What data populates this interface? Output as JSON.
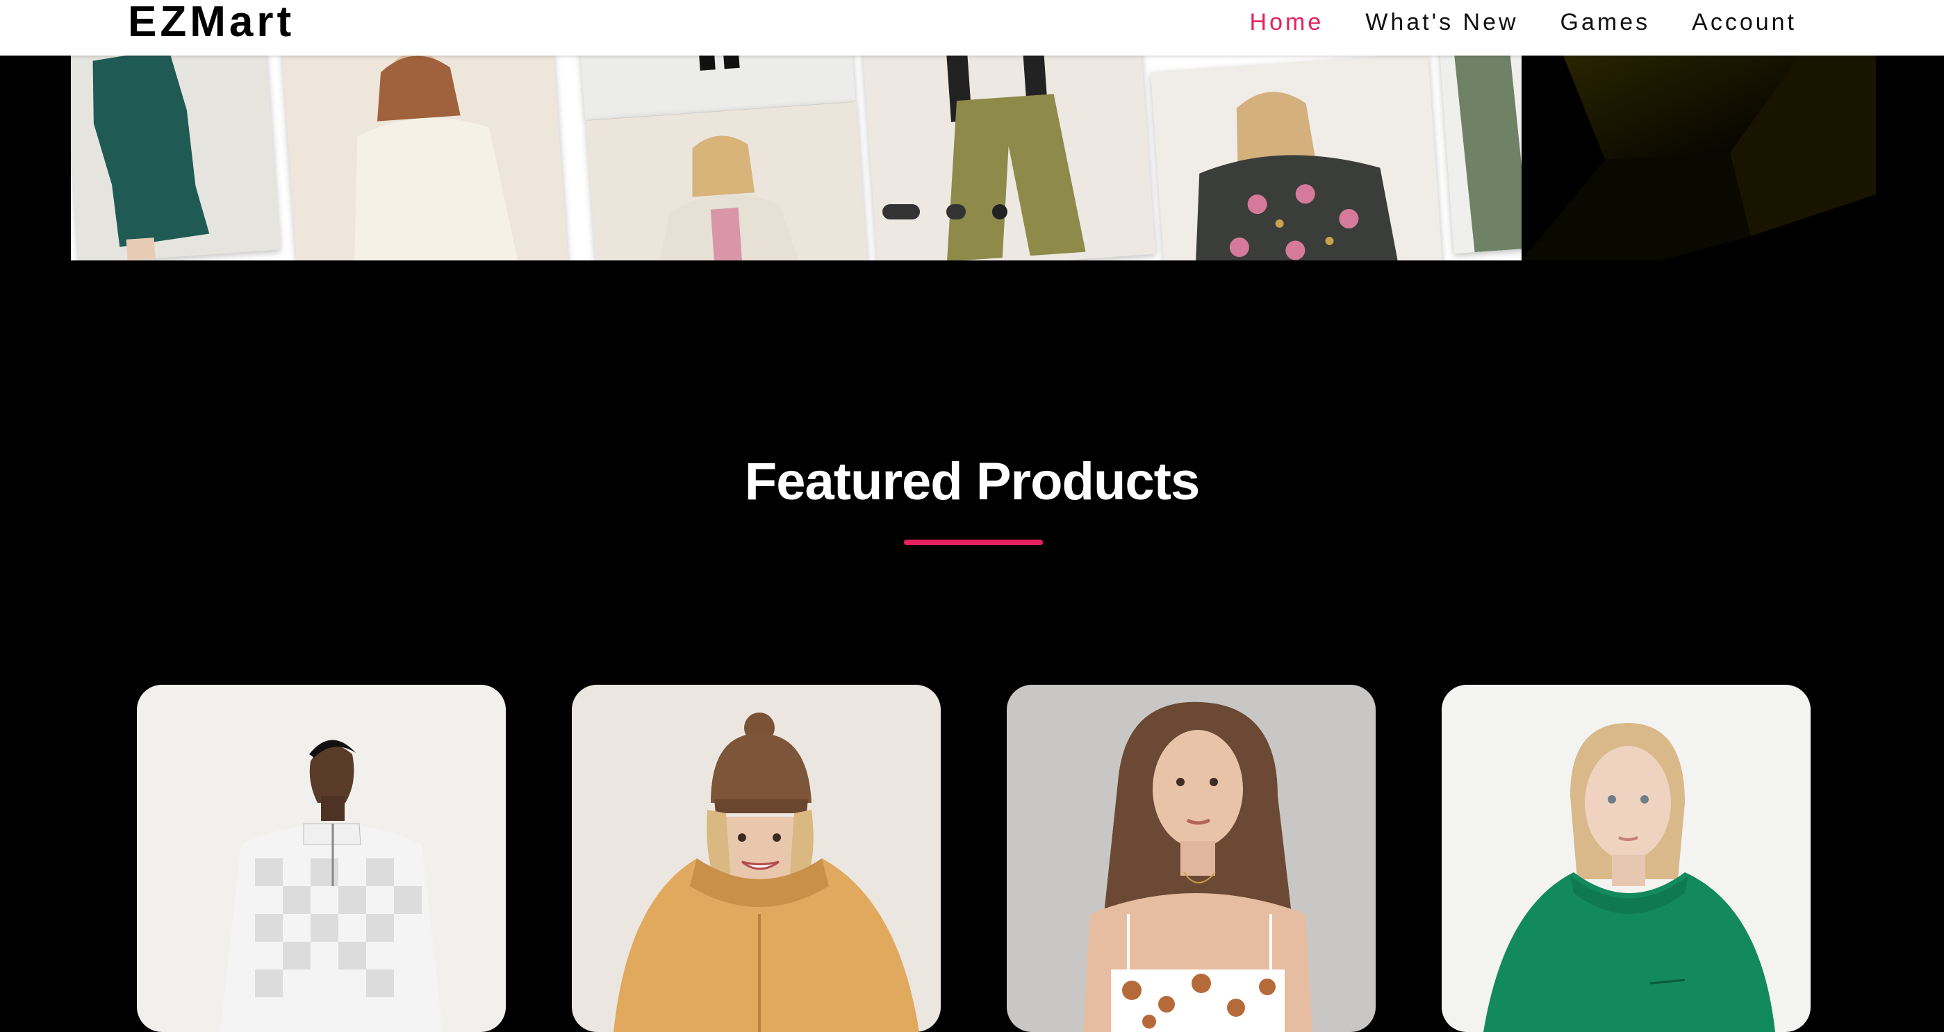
{
  "navbar": {
    "brand": "EZMart",
    "links": [
      {
        "label": "Home",
        "active": true
      },
      {
        "label": "What's New",
        "active": false
      },
      {
        "label": "Games",
        "active": false
      },
      {
        "label": "Account",
        "active": false
      }
    ]
  },
  "colors": {
    "accent": "#e8215e",
    "background": "#000000",
    "navbar_bg": "#ffffff"
  },
  "hero_slider": {
    "slide_count": 3,
    "active_slide": 1
  },
  "featured": {
    "title": "Featured Products",
    "products": [
      {
        "image": "man-checkered-quarter-zip-sweater"
      },
      {
        "image": "woman-mustard-puffer-jacket-beanie"
      },
      {
        "image": "woman-floral-bandeau-top"
      },
      {
        "image": "woman-green-hoodie"
      }
    ]
  }
}
